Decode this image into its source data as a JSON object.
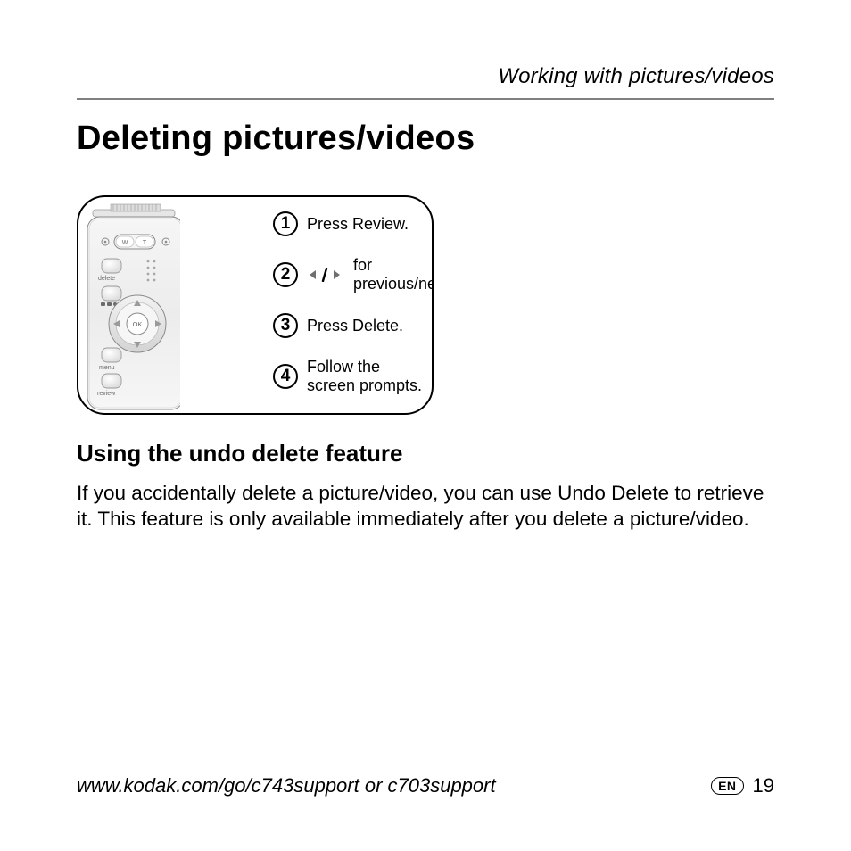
{
  "header": {
    "running_head": "Working with pictures/videos"
  },
  "title": "Deleting pictures/videos",
  "camera": {
    "labels": {
      "delete": "delete",
      "menu": "menu",
      "review": "review",
      "ok": "OK",
      "w": "W",
      "t": "T"
    }
  },
  "steps": [
    {
      "num": "1",
      "text": "Press Review."
    },
    {
      "num": "2",
      "text": "for previous/next."
    },
    {
      "num": "3",
      "text": "Press Delete."
    },
    {
      "num": "4",
      "text": "Follow the screen prompts."
    }
  ],
  "subhead": "Using the undo delete feature",
  "body": "If you accidentally delete a picture/video, you can use Undo Delete to retrieve it. This feature is only available immediately after you delete a picture/video.",
  "footer": {
    "url": "www.kodak.com/go/c743support or c703support",
    "lang": "EN",
    "page": "19"
  }
}
